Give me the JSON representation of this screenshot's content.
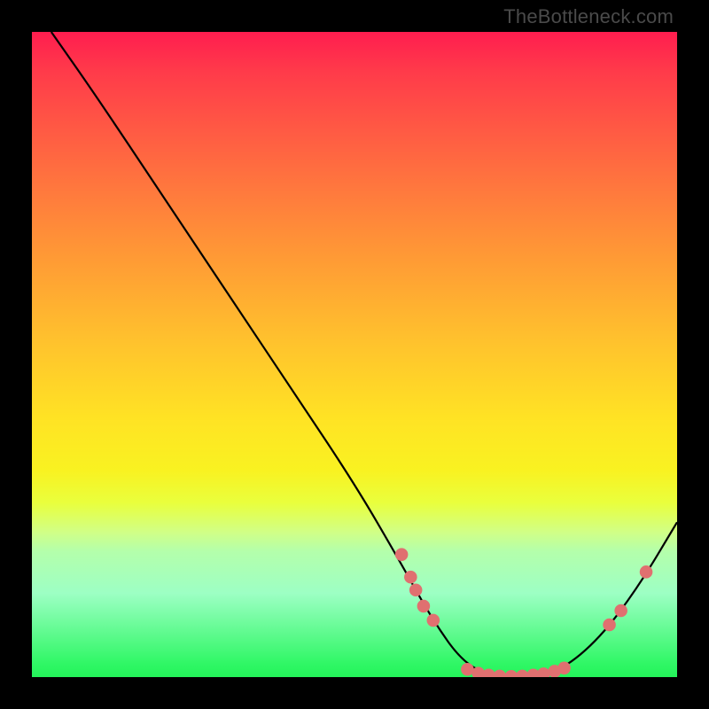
{
  "watermark": "TheBottleneck.com",
  "colors": {
    "dot": "#e07070",
    "curve": "#000000"
  },
  "chart_data": {
    "type": "line",
    "title": "",
    "xlabel": "",
    "ylabel": "",
    "xlim": [
      0,
      100
    ],
    "ylim": [
      0,
      100
    ],
    "grid": false,
    "legend": false,
    "annotations": [
      "TheBottleneck.com"
    ],
    "series": [
      {
        "name": "bottleneck-curve",
        "x": [
          3,
          10,
          20,
          30,
          40,
          50,
          57,
          62,
          67,
          72,
          77,
          82,
          88,
          94,
          100
        ],
        "y": [
          100,
          90,
          75,
          60,
          45,
          30,
          18,
          9,
          2,
          0,
          0,
          1,
          6,
          14,
          24
        ]
      }
    ],
    "points": [
      {
        "name": "left-cluster-1",
        "x": 57.3,
        "y": 19
      },
      {
        "name": "left-cluster-2",
        "x": 58.7,
        "y": 15.5
      },
      {
        "name": "left-cluster-3",
        "x": 59.5,
        "y": 13.5
      },
      {
        "name": "left-cluster-4",
        "x": 60.7,
        "y": 11
      },
      {
        "name": "left-cluster-5",
        "x": 62.2,
        "y": 8.8
      },
      {
        "name": "bottom-1",
        "x": 67.5,
        "y": 1.2
      },
      {
        "name": "bottom-2",
        "x": 69.2,
        "y": 0.6
      },
      {
        "name": "bottom-3",
        "x": 70.8,
        "y": 0.3
      },
      {
        "name": "bottom-4",
        "x": 72.5,
        "y": 0.15
      },
      {
        "name": "bottom-5",
        "x": 74.3,
        "y": 0.1
      },
      {
        "name": "bottom-6",
        "x": 76.0,
        "y": 0.15
      },
      {
        "name": "bottom-7",
        "x": 77.7,
        "y": 0.3
      },
      {
        "name": "bottom-8",
        "x": 79.3,
        "y": 0.5
      },
      {
        "name": "bottom-9",
        "x": 81.0,
        "y": 0.9
      },
      {
        "name": "bottom-10",
        "x": 82.5,
        "y": 1.4
      },
      {
        "name": "right-cluster-1",
        "x": 89.5,
        "y": 8.1
      },
      {
        "name": "right-cluster-2",
        "x": 91.3,
        "y": 10.3
      },
      {
        "name": "right-upper",
        "x": 95.2,
        "y": 16.3
      }
    ]
  }
}
